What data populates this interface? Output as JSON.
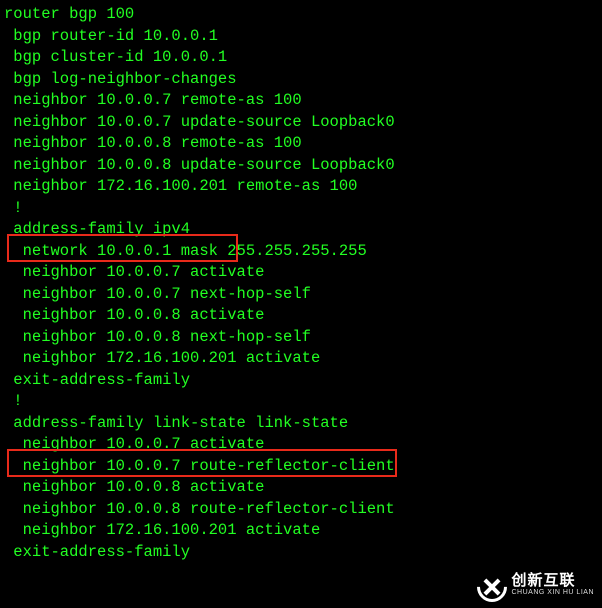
{
  "config": {
    "lines": [
      "router bgp 100",
      " bgp router-id 10.0.0.1",
      " bgp cluster-id 10.0.0.1",
      " bgp log-neighbor-changes",
      " neighbor 10.0.0.7 remote-as 100",
      " neighbor 10.0.0.7 update-source Loopback0",
      " neighbor 10.0.0.8 remote-as 100",
      " neighbor 10.0.0.8 update-source Loopback0",
      " neighbor 172.16.100.201 remote-as 100",
      " !",
      " address-family ipv4",
      "  network 10.0.0.1 mask 255.255.255.255",
      "  neighbor 10.0.0.7 activate",
      "  neighbor 10.0.0.7 next-hop-self",
      "  neighbor 10.0.0.8 activate",
      "  neighbor 10.0.0.8 next-hop-self",
      "  neighbor 172.16.100.201 activate",
      " exit-address-family",
      " !",
      " address-family link-state link-state",
      "  neighbor 10.0.0.7 activate",
      "  neighbor 10.0.0.7 route-reflector-client",
      "  neighbor 10.0.0.8 activate",
      "  neighbor 10.0.0.8 route-reflector-client",
      "  neighbor 172.16.100.201 activate",
      " exit-address-family"
    ]
  },
  "highlights": {
    "box1_line": "address-family ipv4",
    "box2_line": "address-family link-state link-state"
  },
  "watermark": {
    "zh": "创新互联",
    "py": "CHUANG XIN HU LIAN"
  }
}
